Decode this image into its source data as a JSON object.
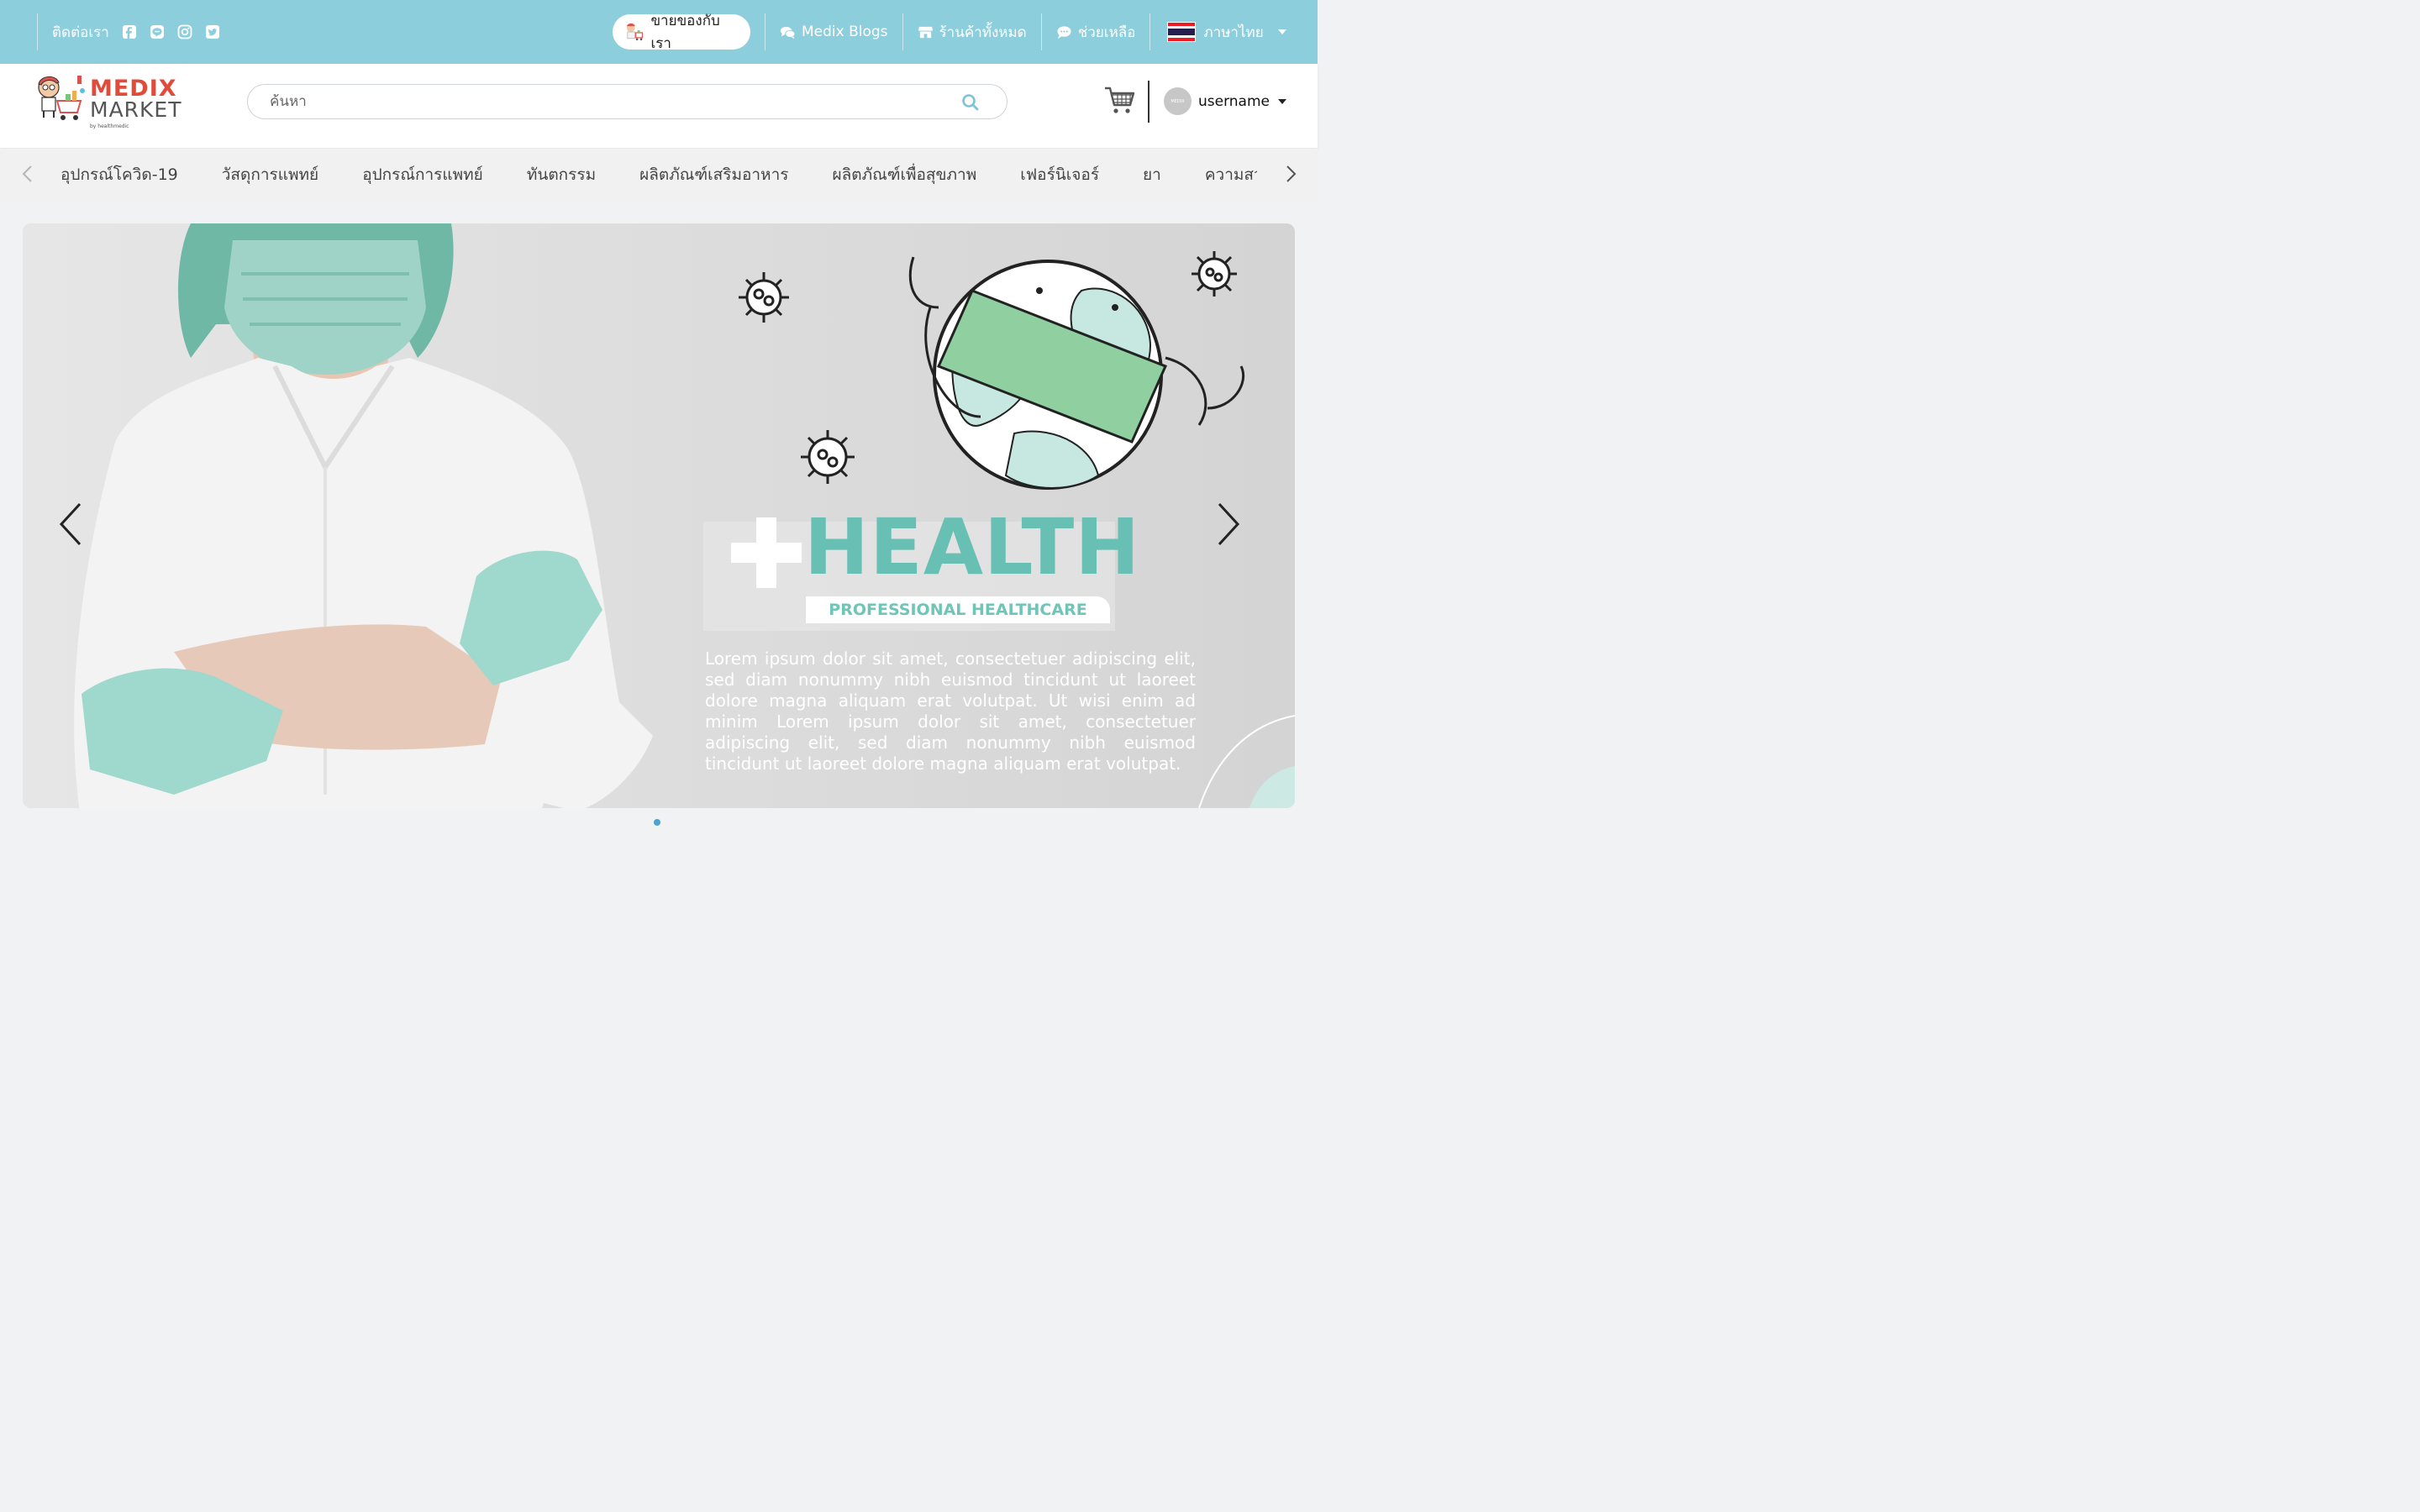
{
  "topbar": {
    "contact_label": "ติดต่อเรา",
    "social_icons": [
      "facebook-icon",
      "line-icon",
      "instagram-icon",
      "twitter-icon"
    ],
    "sell_label": "ขายของกับเรา",
    "links": [
      {
        "icon": "chat-bubbles-icon",
        "label": "Medix Blogs"
      },
      {
        "icon": "store-icon",
        "label": "ร้านค้าทั้งหมด"
      },
      {
        "icon": "help-chat-icon",
        "label": "ช่วยเหลือ"
      }
    ],
    "language_label": "ภาษาไทย",
    "accent": "#8dcedd"
  },
  "header": {
    "logo": {
      "line1": "MEDIX",
      "line2": "MARKET",
      "tagline": "by healthmedic"
    },
    "search_placeholder": "ค้นหา",
    "username": "username",
    "avatar_text": "MEDIX"
  },
  "categories": [
    "อุปกรณ์โควิด-19",
    "วัสดุการแพทย์",
    "อุปกรณ์การแพทย์",
    "ทันตกรรม",
    "ผลิตภัณฑ์เสริมอาหาร",
    "ผลิตภัณฑ์เพื่อสุขภาพ",
    "เฟอร์นิเจอร์",
    "ยา",
    "ความสวย"
  ],
  "banner": {
    "title": "HEALTH",
    "subtitle": "PROFESSIONAL HEALTHCARE",
    "body": "Lorem ipsum dolor sit amet, consectetuer adipiscing elit, sed diam nonummy nibh euismod tincidunt ut laoreet dolore magna aliquam erat volutpat. Ut wisi enim ad minim Lorem ipsum dolor sit amet, consectetuer adipiscing elit, sed diam nonummy nibh euismod tincidunt ut laoreet dolore magna aliquam erat volutpat.",
    "title_color": "#68bfb4"
  }
}
